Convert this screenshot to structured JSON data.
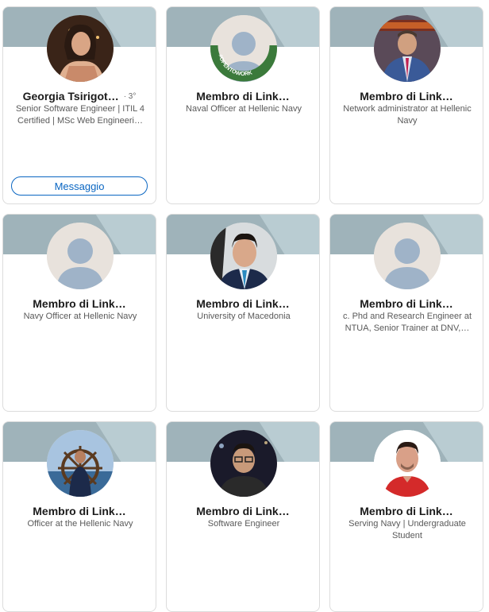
{
  "colors": {
    "banner": "#b9ccd2",
    "banner_shape": "#9fb3ba",
    "accent": "#0a66c2",
    "open_to_work": "#3b7a3b"
  },
  "cards": [
    {
      "name": "Georgia Tsirigot…",
      "degree": "· 3°",
      "headline": "Senior Software Engineer | ITIL 4 Certified | MSc Web Engineeri…",
      "button": "Messaggio",
      "avatar": "woman-photo"
    },
    {
      "name": "Membro di Link…",
      "headline": "Naval Officer at Hellenic Navy",
      "avatar": "placeholder-open-to-work",
      "badge_text": "#OPENTOWORK"
    },
    {
      "name": "Membro di Link…",
      "headline": "Network administrator at Hellenic Navy",
      "avatar": "man-suit-photo"
    },
    {
      "name": "Membro di Link…",
      "headline": "Navy Officer at Hellenic Navy",
      "avatar": "placeholder"
    },
    {
      "name": "Membro di Link…",
      "headline": "University of Macedonia",
      "avatar": "man-tie-photo"
    },
    {
      "name": "Membro di Link…",
      "headline": "c. Phd and Research Engineer at NTUA, Senior Trainer at DNV,…",
      "avatar": "placeholder"
    },
    {
      "name": "Membro di Link…",
      "headline": "Officer at the Hellenic Navy",
      "avatar": "ship-wheel-photo"
    },
    {
      "name": "Membro di Link…",
      "headline": "Software Engineer",
      "avatar": "man-glasses-photo"
    },
    {
      "name": "Membro di Link…",
      "headline": "Serving Navy | Undergraduate Student",
      "avatar": "man-red-shirt-photo"
    }
  ]
}
